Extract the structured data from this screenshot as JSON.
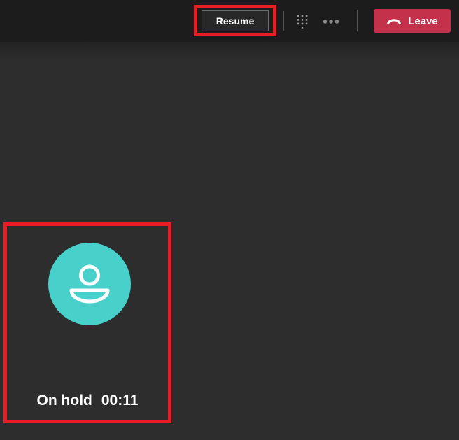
{
  "topbar": {
    "resume_button": {
      "label": "Resume"
    },
    "dialpad_icon": "dialpad-icon",
    "more_options_icon": "more-options-icon",
    "leave_button": {
      "label": "Leave",
      "icon": "hangup-phone-icon"
    }
  },
  "participant": {
    "avatar_icon": "person-icon",
    "status_label": "On hold",
    "timer": "00:11"
  },
  "annotations": {
    "color": "#ec1c24",
    "highlighted_elements": [
      "resume-button",
      "participant-tile"
    ]
  },
  "colors": {
    "topbar_bg": "#1d1c1c",
    "stage_bg": "#2e2d2d",
    "leave_button_bg": "#c4314b",
    "avatar_teal": "#48d1cb",
    "annotation_red": "#ec1c24"
  }
}
